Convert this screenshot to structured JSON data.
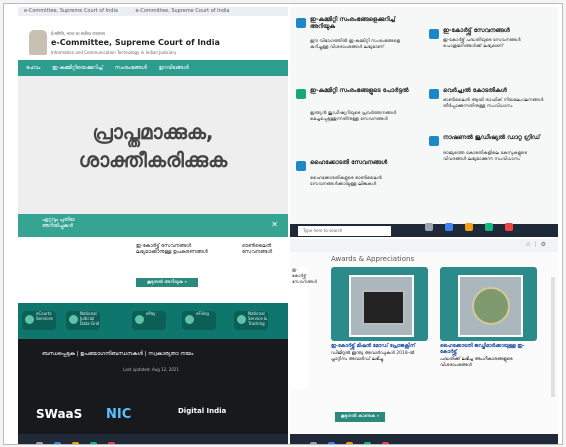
{
  "top_left": {
    "browser_tabs": [
      "e-Committee, Supreme Court of India",
      "e-Committee, Supreme Court of India"
    ],
    "header_line1": "ई-समिति, भारत का सर्वोच्च न्यायालय",
    "header_line2": "e-Committee, Supreme Court of India",
    "header_line3": "Information and Communication Technology in Indian Judiciary",
    "nav_items": [
      "ഹോം",
      "ഇ-കമ്മിറ്റിയെക്കുറിച്ച്",
      "സംരംഭങ്ങൾ",
      "ഉറവിടങ്ങൾ"
    ],
    "hero_line1": "പ്രാപ്തമാക്കുക,",
    "hero_line2": "ശാക്തീകരിക്കുക",
    "footer_text": "ഏറ്റവും പുതിയ അറിയിപ്പുകൾ"
  },
  "top_right": {
    "cards": [
      {
        "title": "ഇ-കമ്മിറ്റി സംരംഭങ്ങളെക്കുറിച്ച് അറിയുക",
        "text": "ഈ വിഭാഗത്തിൽ ഇ-കമ്മിറ്റി സംരംഭങ്ങളെ കുറിച്ചുള്ള വിശദാംശങ്ങൾ ലഭ്യമാണ്"
      },
      {
        "title": "ഇ-കമ്മിറ്റി സംരംഭങ്ങളുടെ പോർട്ടൽ",
        "text": "ഇന്ത്യൻ ജുഡീഷ്യറിയുടെ പ്രവർത്തനങ്ങൾ മെച്ചപ്പെടുത്തുന്നതിനുള്ള സേവനങ്ങൾ"
      },
      {
        "title": "ഹൈക്കോടതി സേവനങ്ങൾ",
        "text": "ഹൈക്കോടതികളുടെ ഓൺലൈൻ സേവനങ്ങൾക്കായുള്ള ലിങ്കുകൾ"
      },
      {
        "title": "ഇ-കോർട്ട്സ് സേവനങ്ങൾ",
        "text": "ഇ-കോർട്ട്സ് പദ്ധതിയുടെ സേവനങ്ങൾ പൊതുജനങ്ങൾക്ക് ലഭ്യമാണ്"
      },
      {
        "title": "വെർച്ച്വൽ കോടതികൾ",
        "text": "ഓൺലൈൻ ആയി ട്രാഫിക് നിയമലംഘനങ്ങൾ തീർപ്പാക്കുന്നതിനുള്ള സംവിധാനം"
      },
      {
        "title": "നാഷണൽ ജുഡീഷ്യൽ ഡാറ്റ ഗ്രിഡ്",
        "text": "രാജ്യത്തെ കോടതികളിലെ കേസുകളുടെ വിവരങ്ങൾ ലഭ്യമാക്കുന്ന സംവിധാനം"
      }
    ],
    "search_placeholder": "Type here to search"
  },
  "bottom_left": {
    "top_text_1": "ഇ-കോർട്ട്സ് സേവനങ്ങൾ ലഭ്യമാക്കാനുള്ള ഉപകരണങ്ങൾ",
    "top_text_2": "ഓൺലൈൻ സേവനങ്ങൾ",
    "button": "കൂടുതൽ അറിയുക »",
    "badges": [
      "eCourts Services",
      "National Judicial Data Grid",
      "ePay",
      "eFiling",
      "National Service & Tracking"
    ],
    "dark_title": "ബന്ധപ്പെടുക | ഉപയോഗനിബന്ധനകൾ | സ്വകാര്യതാ നയം",
    "dark_text": "Last updated: Aug 12, 2021",
    "logos": [
      "SWaaS",
      "NIC",
      "Digital India"
    ]
  },
  "bottom_right": {
    "heading": "Awards & Appreciations",
    "items": [
      {
        "title": "ഇ-കോർട്ട്സ് മിഷൻ മോഡ് പ്രോജക്റ്റിന്",
        "text": "ഡിജിറ്റൽ ഇന്ത്യ അവാർഡുകൾ 2018-ൽ പ്ലാറ്റിനം അവാർഡ് ലഭിച്ചു"
      },
      {
        "title": "ഹൈക്കോടതി ജഡ്ജിമാർക്കായുള്ള ഇ-കോർട്ട്സ്",
        "text": "പദ്ധതിക്ക് ലഭിച്ച അംഗീകാരങ്ങളുടെ വിശദാംശങ്ങൾ"
      }
    ],
    "button": "കൂടുതൽ കാണുക »",
    "left_text": "ഇ-കോർട്ട്സ് സേവനങ്ങൾ"
  }
}
